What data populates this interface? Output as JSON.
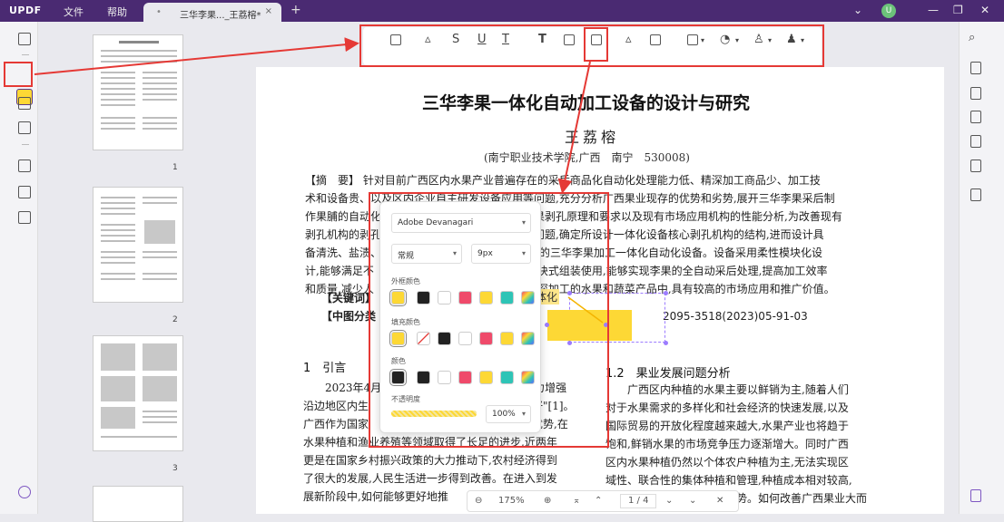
{
  "app": {
    "logo": "UPDF",
    "menu": [
      "文件",
      "帮助"
    ],
    "tab_title": "三华李果..._王荔榕*",
    "tab_dot": "•",
    "tab_close": "×",
    "new_tab": "+",
    "avatar": "U"
  },
  "window": {
    "chevron": "⌄",
    "minimize": "—",
    "restore": "❐",
    "close": "✕"
  },
  "toolbar_glyphs": {
    "strike": "S",
    "underline": "U",
    "squiggle": "T",
    "text": "T"
  },
  "thumbnails": [
    "1",
    "2",
    "3"
  ],
  "document": {
    "title": "三华李果一体化自动加工设备的设计与研究",
    "author": "王荔榕",
    "affiliation": "(南宁职业技术学院,广西　南宁　530008)",
    "abstract_lines": [
      "【摘　要】 针对目前广西区内水果产业普遍存在的采后商品化自动化处理能力低、精深加工商品少、加工技",
      "术和设备贵、以及区内企业自主研发设备应用等问题,充分分析广西果业现存的优势和劣势,展开三华李果采后制",
      "作果脯的自动化　　　　　　　　　　　　　作果剥孔原理和要求以及现有市场应用机构的性能分析,为改善现有",
      "剥孔机构的剥孔　　　　　　　　　　　　　等问题,确定所设计一体化设备核心剥孔机构的结构,进而设计具",
      "备清洗、盐渍、　　　　　　　　　　　　　控制的三华李果加工一体化自动化设备。设备采用柔性模块化设",
      "计,能够满足不　　　　　　　　　　　　　分模块式组装使用,能够实现李果的全自动采后处理,提高加工效率",
      "和质量,减少人　　　　　　　　　　　　　果的深加工的水果和蔬菜产品中,具有较高的市场应用和推广价值。"
    ],
    "keywords_label": "【关键词】",
    "clc_label": "【中图分类",
    "doc_code": "2095-3518(2023)05-91-03",
    "section1_heading": "1　引言",
    "left_lines": [
      "　　2023年4月　　　　　　　　　　　　　着力增强",
      "沿边地区内生　　　　　　　　　　　　　　国好\"[1]。",
      "广西作为国家　　　　　　　　　　　　　　业优势,在",
      "水果种植和渔业养殖等领域取得了长足的进步,近两年",
      "更是在国家乡村振兴政策的大力推动下,农村经济得到",
      "了很大的发展,人民生活进一步得到改善。在进入到发",
      "展新阶段中,如何能够更好地推"
    ],
    "section2_heading": "1.2　果业发展问题分析",
    "right_lines": [
      "　　广西区内种植的水果主要以鲜销为主,随着人们",
      "对于水果需求的多样化和社会经济的快速发展,以及",
      "国际贸易的开放化程度越来越大,水果产业也将趋于",
      "饱和,鲜销水果的市场竞争压力逐渐增大。同时广西",
      "区内水果种植仍然以个体农户种植为主,无法实现区",
      "域性、联合性的集体种植和管理,种植成本相对较高,",
      "　　　　　　　　　　　优势。如何改善广西果业大而"
    ],
    "highlight_text": "体化"
  },
  "popup": {
    "font": "Adobe Devanagari",
    "style": "常规",
    "size": "9px",
    "border_color_label": "外框颜色",
    "fill_color_label": "填充颜色",
    "color_label": "颜色",
    "opacity_label": "不透明度",
    "opacity_value": "100%",
    "border_colors": [
      "#fdd835",
      "#222222",
      "#ffffff",
      "#ef4a6a",
      "#fdd835",
      "#2ec4b6",
      "rainbow"
    ],
    "fill_colors": [
      "#fdd835",
      "none",
      "#222222",
      "#ffffff",
      "#ef4a6a",
      "#fdd835",
      "rainbow"
    ],
    "text_colors": [
      "#222222",
      "#222222",
      "#ffffff",
      "#ef4a6a",
      "#fdd835",
      "#2ec4b6",
      "rainbow"
    ]
  },
  "bottom": {
    "zoom_out": "⊖",
    "zoom": "175%",
    "zoom_in": "⊕",
    "first": "⌅",
    "prev": "⌃",
    "page": "1 / 4",
    "next": "⌄",
    "last": "⌄",
    "close": "✕"
  },
  "accent_colors": {
    "title_bar": "#4a2a72",
    "highlight": "#fdd835",
    "callout": "#e53935"
  }
}
